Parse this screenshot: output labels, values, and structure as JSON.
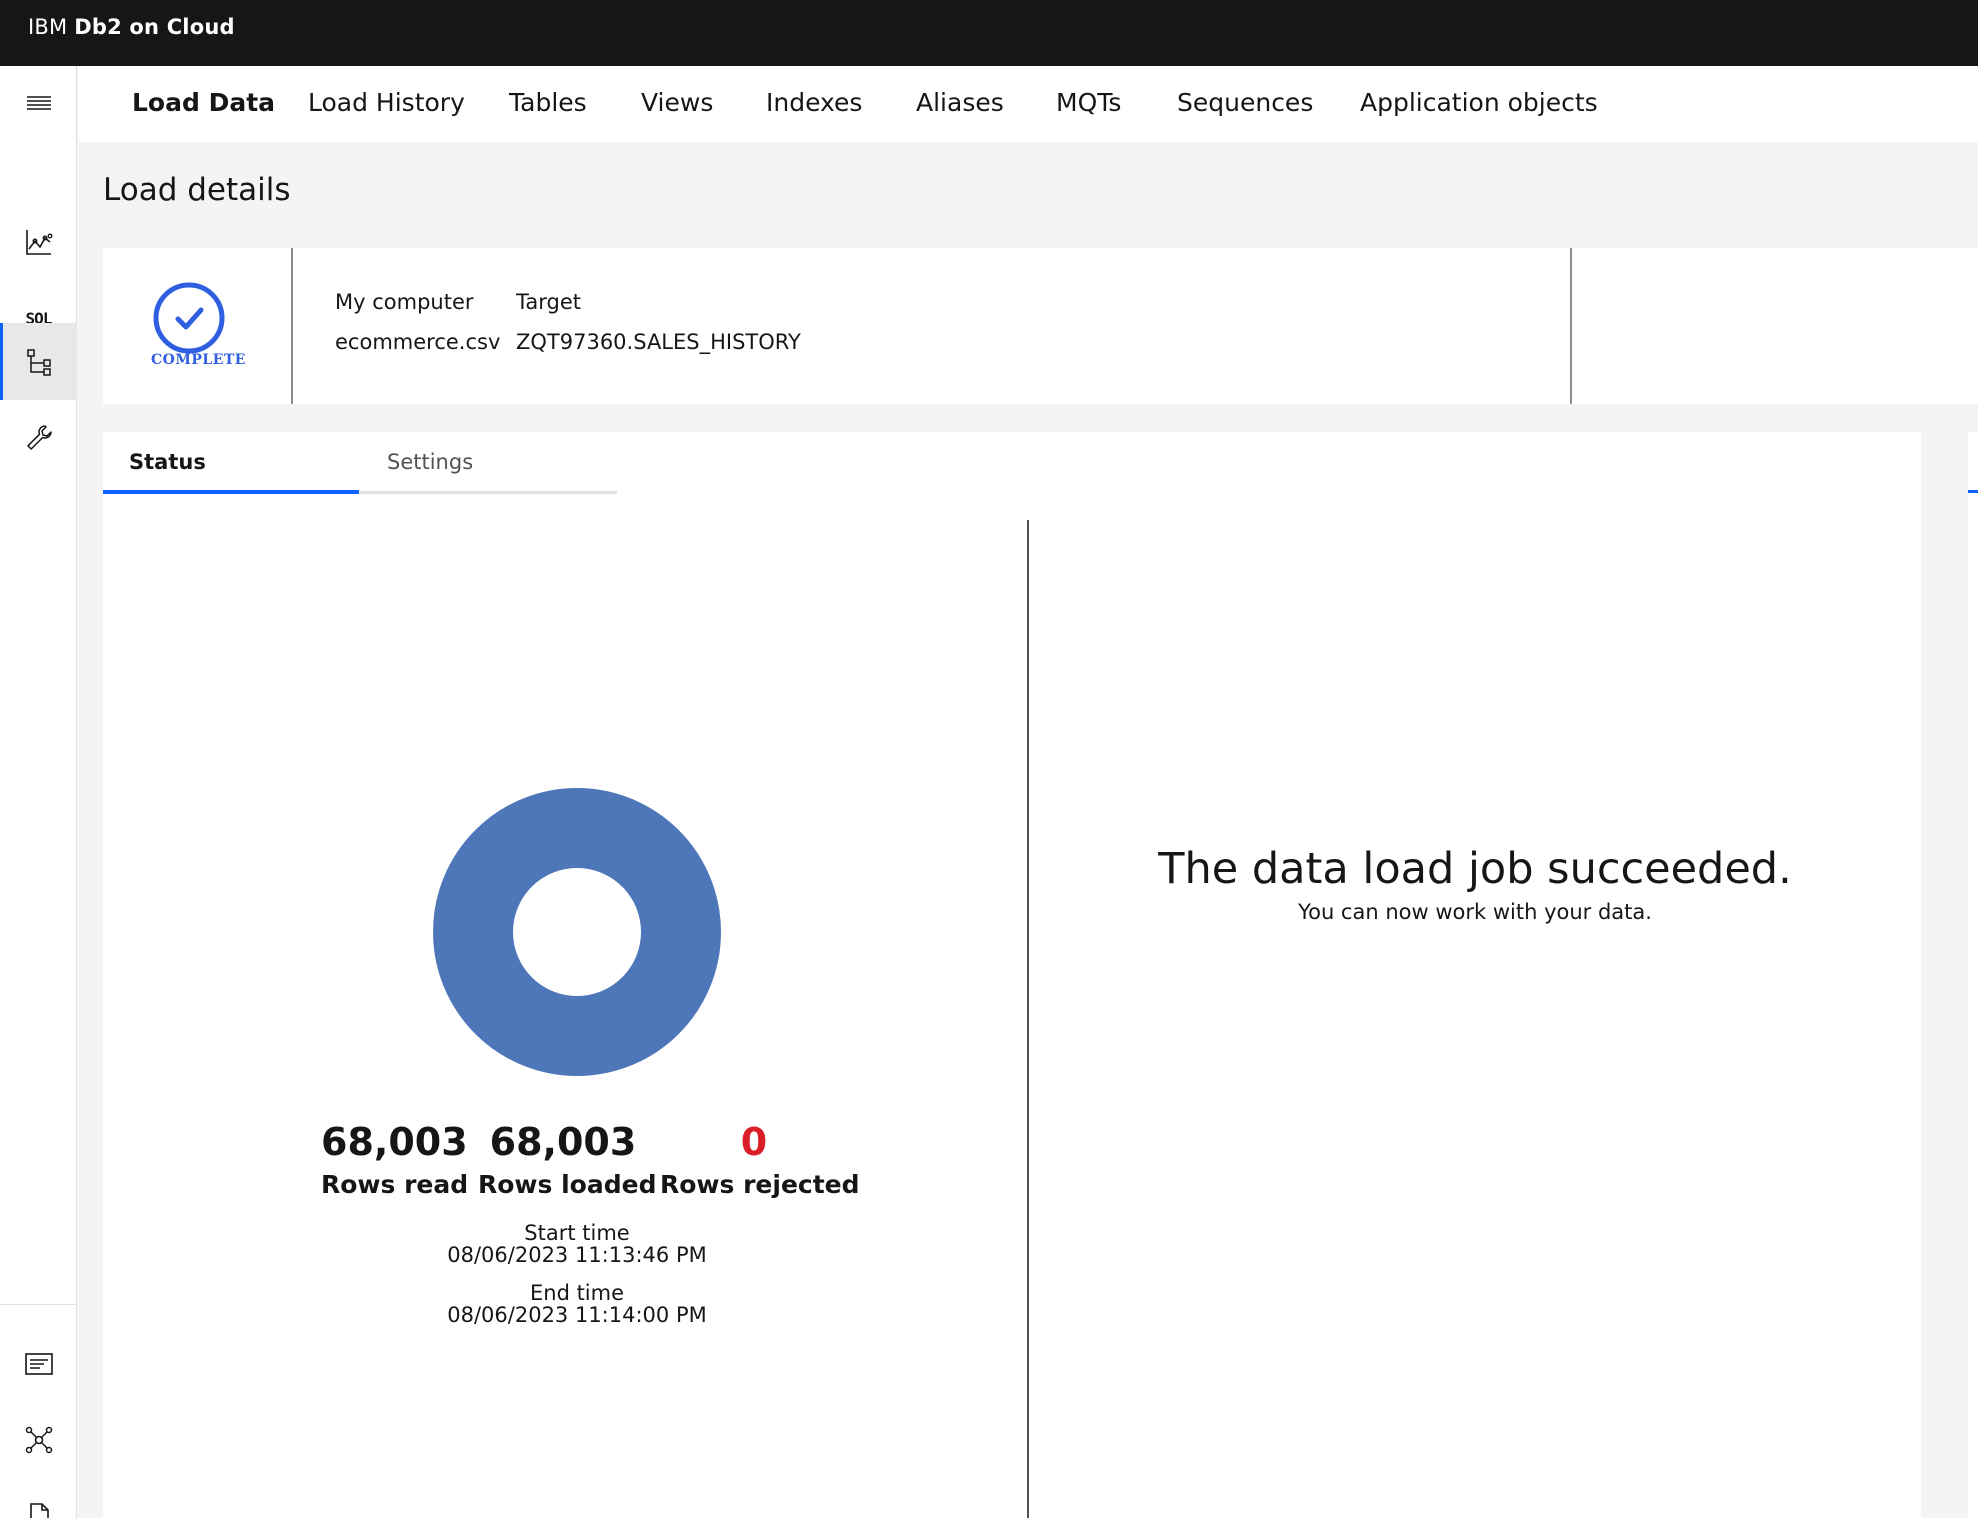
{
  "header": {
    "brand_prefix": "IBM",
    "brand_name": "Db2 on Cloud"
  },
  "rail": {
    "items": [
      {
        "name": "menu-icon"
      },
      {
        "name": "monitor-chart-icon"
      },
      {
        "name": "sql-icon",
        "label": "SQL"
      },
      {
        "name": "data-tree-icon",
        "active": true
      },
      {
        "name": "wrench-icon"
      },
      {
        "name": "notifications-icon"
      },
      {
        "name": "network-icon"
      },
      {
        "name": "document-icon"
      }
    ]
  },
  "nav": {
    "tabs": [
      {
        "label": "Load Data",
        "active": true
      },
      {
        "label": "Load History"
      },
      {
        "label": "Tables"
      },
      {
        "label": "Views"
      },
      {
        "label": "Indexes"
      },
      {
        "label": "Aliases"
      },
      {
        "label": "MQTs"
      },
      {
        "label": "Sequences"
      },
      {
        "label": "Application objects"
      }
    ]
  },
  "page": {
    "title": "Load details"
  },
  "summary": {
    "status": "COMPLETE",
    "source_heading": "My computer",
    "source_value": "ecommerce.csv",
    "target_heading": "Target",
    "target_value": "ZQT97360.SALES_HISTORY"
  },
  "tabs": {
    "status": "Status",
    "settings": "Settings"
  },
  "stats": {
    "rows_read": {
      "value": "68,003",
      "label": "Rows read"
    },
    "rows_loaded": {
      "value": "68,003",
      "label": "Rows loaded"
    },
    "rows_rejected": {
      "value": "0",
      "label": "Rows rejected"
    },
    "start_label": "Start time",
    "start_value": "08/06/2023 11:13:46 PM",
    "end_label": "End time",
    "end_value": "08/06/2023 11:14:00 PM"
  },
  "result": {
    "title": "The data load job succeeded.",
    "subtitle": "You can now work with your data."
  },
  "colors": {
    "donut": "#4d77b9",
    "accent": "#0f62fe",
    "status_blue": "#2f5fe0",
    "rejected": "#da1e28"
  }
}
